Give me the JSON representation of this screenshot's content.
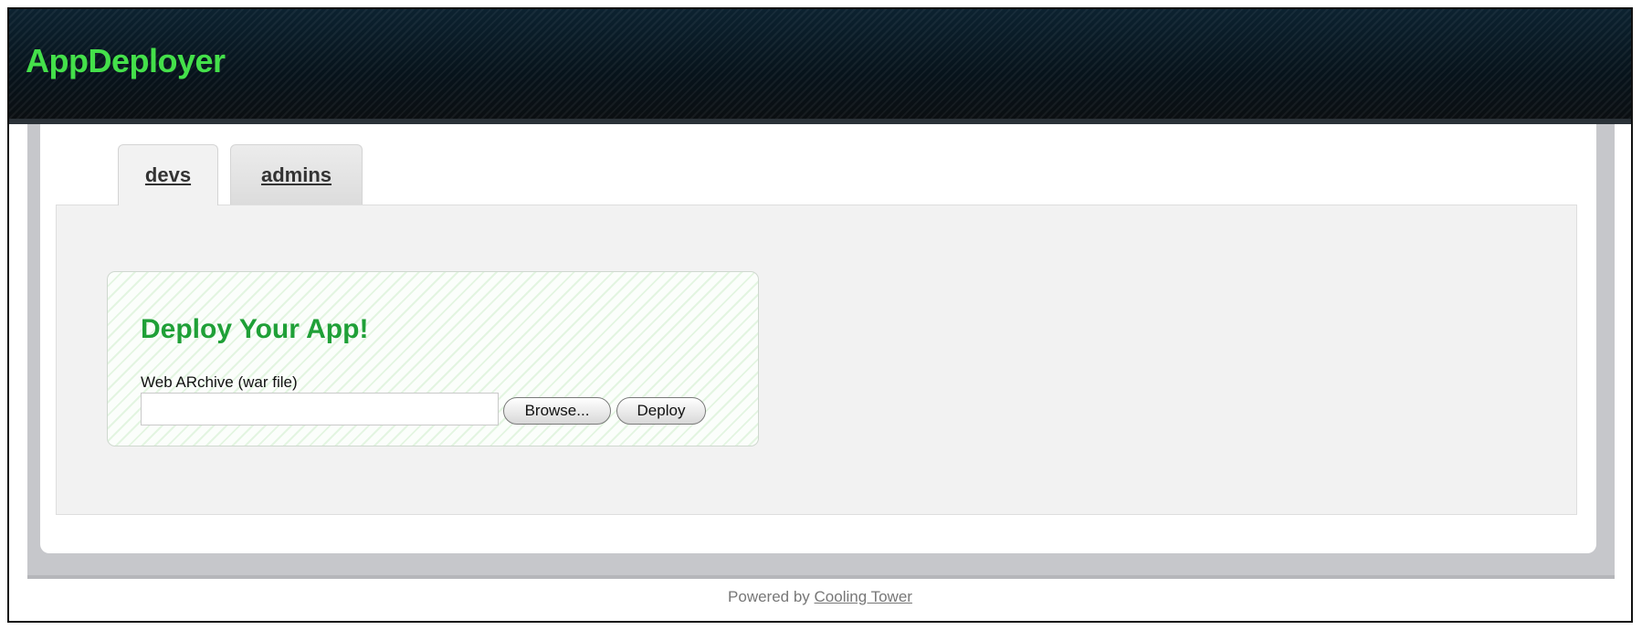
{
  "header": {
    "brand": "AppDeployer"
  },
  "tabs": [
    {
      "label": "devs",
      "active": true
    },
    {
      "label": "admins",
      "active": false
    }
  ],
  "deploy": {
    "title": "Deploy Your App!",
    "field_label": "Web ARchive (war file)",
    "file_value": "",
    "browse_label": "Browse...",
    "deploy_label": "Deploy"
  },
  "footer": {
    "prefix": "Powered by ",
    "link_text": "Cooling Tower"
  },
  "colors": {
    "brand": "#44e04a",
    "title_green": "#1fa037",
    "header_bg": "#0a1a24"
  }
}
